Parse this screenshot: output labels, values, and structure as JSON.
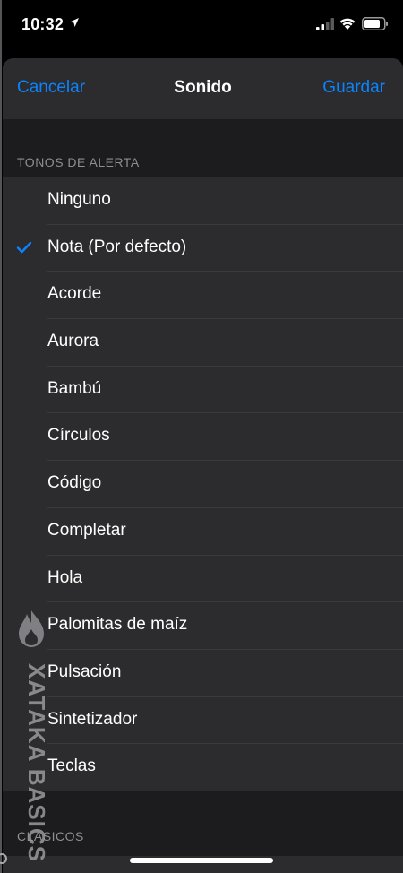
{
  "status_bar": {
    "time": "10:32",
    "icons": [
      "location-arrow-icon",
      "cellular-signal-icon",
      "wifi-icon",
      "battery-icon"
    ]
  },
  "nav": {
    "cancel_label": "Cancelar",
    "title": "Sonido",
    "save_label": "Guardar"
  },
  "sections": {
    "alert_tones_header": "TONOS DE ALERTA",
    "classics_header": "CLÁSICOS"
  },
  "alert_tones": [
    {
      "label": "Ninguno",
      "selected": false
    },
    {
      "label": "Nota (Por defecto)",
      "selected": true
    },
    {
      "label": "Acorde",
      "selected": false
    },
    {
      "label": "Aurora",
      "selected": false
    },
    {
      "label": "Bambú",
      "selected": false
    },
    {
      "label": "Círculos",
      "selected": false
    },
    {
      "label": "Código",
      "selected": false
    },
    {
      "label": "Completar",
      "selected": false
    },
    {
      "label": "Hola",
      "selected": false
    },
    {
      "label": "Palomitas de maíz",
      "selected": false
    },
    {
      "label": "Pulsación",
      "selected": false
    },
    {
      "label": "Sintetizador",
      "selected": false
    },
    {
      "label": "Teclas",
      "selected": false
    }
  ],
  "watermark": {
    "text": "XATAKA BASICS"
  },
  "colors": {
    "accent": "#0a84ff",
    "background": "#000000",
    "sheet": "#1c1c1e",
    "cell": "#2c2c2e",
    "separator": "#3a3a3c",
    "secondary_text": "#8e8e93"
  }
}
